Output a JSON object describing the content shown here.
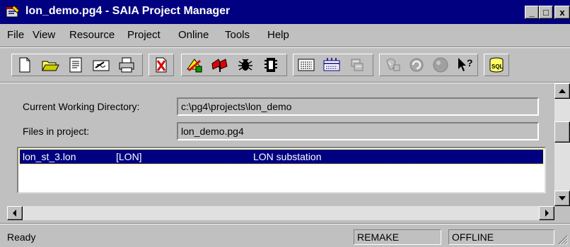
{
  "window": {
    "title": "lon_demo.pg4 - SAIA Project Manager",
    "minimize_glyph": "_",
    "maximize_glyph": "□",
    "close_glyph": "x"
  },
  "menu": [
    "File",
    "View",
    "Resource",
    "Project",
    "Online",
    "Tools",
    "Help"
  ],
  "toolbar_icons": [
    "new-file-icon",
    "open-folder-icon",
    "properties-icon",
    "edit-icon",
    "print-icon",
    "delete-file-icon",
    "build-icon",
    "flag-icon",
    "bug-icon",
    "cpu-icon",
    "keyboard-icon",
    "network-icon",
    "copy-disabled-icon",
    "lamp-disabled-icon",
    "refresh-disabled-icon",
    "stop-disabled-icon",
    "help-pointer-icon",
    "database-icon"
  ],
  "project": {
    "cwd_label": "Current Working Directory:",
    "cwd_value": "c:\\pg4\\projects\\lon_demo",
    "files_label": "Files in project:",
    "files_value": "lon_demo.pg4"
  },
  "files": [
    {
      "name": "lon_st_3.lon",
      "type": "[LON]",
      "description": "LON substation"
    }
  ],
  "status": {
    "text": "Ready",
    "remake": "REMAKE",
    "mode": "OFFLINE"
  },
  "colors": {
    "title_bar": "#000080",
    "selection": "#000080",
    "face": "#c0c0c0"
  }
}
